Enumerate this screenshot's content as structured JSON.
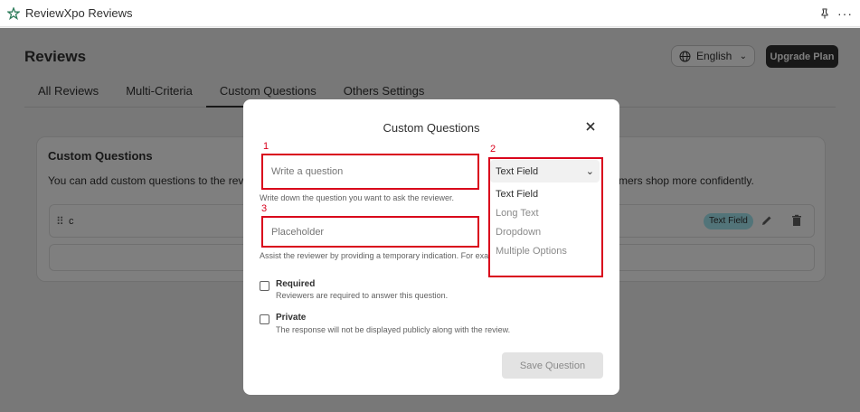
{
  "app": {
    "title": "ReviewXpo Reviews",
    "more_label": "···"
  },
  "page": {
    "title": "Reviews",
    "language": {
      "value": "English",
      "chevron": "⌄"
    },
    "upgrade_label": "Upgrade Plan",
    "tabs": [
      {
        "label": "All Reviews",
        "active": false
      },
      {
        "label": "Multi-Criteria",
        "active": false
      },
      {
        "label": "Custom Questions",
        "active": true
      },
      {
        "label": "Others Settings",
        "active": false
      }
    ],
    "card": {
      "title": "Custom Questions",
      "desc_left": "You can add custom questions to the review",
      "desc_right": "mers shop more confidently.",
      "question_text": "c",
      "question_type": "Text Field",
      "drag_glyph": "⠿"
    }
  },
  "modal": {
    "title": "Custom Questions",
    "question_placeholder": "Write a question",
    "question_help": "Write down the question you want to ask the reviewer.",
    "placeholder_placeholder": "Placeholder",
    "placeholder_help": "Assist the reviewer by providing a temporary indication. For exa",
    "type_select": {
      "value": "Text Field",
      "chevron": "⌄",
      "options": [
        "Text Field",
        "Long Text",
        "Dropdown",
        "Multiple Options"
      ],
      "selected_index": 0
    },
    "required": {
      "label": "Required",
      "desc": "Reviewers are required to answer this question.",
      "checked": false
    },
    "private": {
      "label": "Private",
      "desc": "The response will not be displayed publicly along with the review.",
      "checked": false
    },
    "save_label": "Save Question"
  },
  "annotations": [
    "1",
    "2",
    "3"
  ],
  "colors": {
    "annotation": "#d9001b",
    "primary_button": "#303030",
    "badge": "#a4e8f2"
  },
  "icons": [
    "app-logo-icon",
    "pin-icon",
    "more-icon",
    "globe-icon",
    "chevron-down-icon",
    "drag-handle-icon",
    "edit-icon",
    "trash-icon",
    "close-icon"
  ]
}
